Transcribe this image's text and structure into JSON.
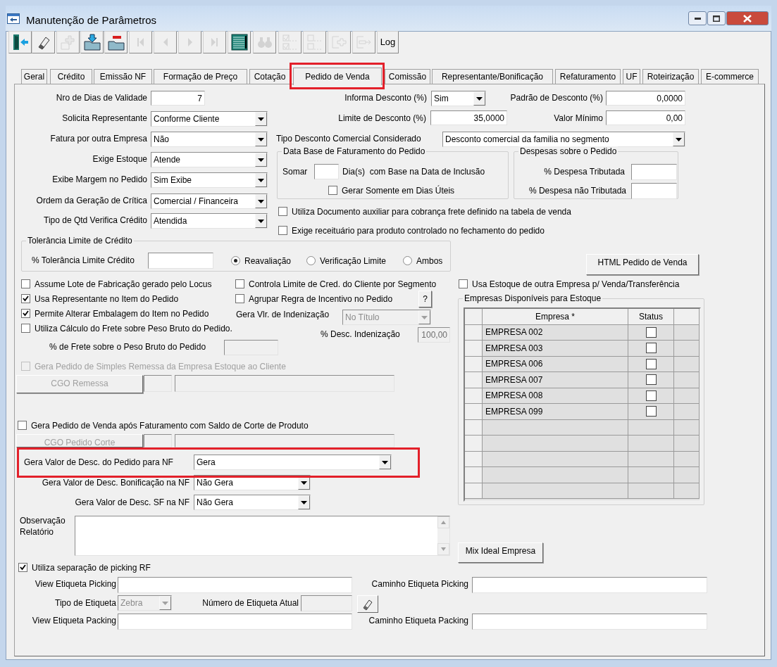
{
  "window": {
    "title": "Manutenção de Parâmetros"
  },
  "toolbar": [
    {
      "kind": "exit",
      "disabled": false
    },
    {
      "kind": "eraser",
      "disabled": false
    },
    {
      "kind": "add",
      "disabled": true
    },
    {
      "kind": "save",
      "disabled": false
    },
    {
      "kind": "delete",
      "disabled": false
    },
    {
      "kind": "first",
      "disabled": true
    },
    {
      "kind": "prev",
      "disabled": true
    },
    {
      "kind": "next",
      "disabled": true
    },
    {
      "kind": "last",
      "disabled": true
    },
    {
      "kind": "grid",
      "disabled": false
    },
    {
      "kind": "find",
      "disabled": true
    },
    {
      "kind": "check-all",
      "disabled": true
    },
    {
      "kind": "uncheck-all",
      "disabled": true
    },
    {
      "kind": "insert",
      "disabled": true
    },
    {
      "kind": "export",
      "disabled": true
    },
    {
      "kind": "text",
      "label": "Log",
      "disabled": false
    }
  ],
  "tabs": [
    {
      "label": "Geral",
      "selected": false
    },
    {
      "label": "Crédito",
      "selected": false
    },
    {
      "label": "Emissão NF",
      "selected": false
    },
    {
      "label": "Formação de Preço",
      "selected": false
    },
    {
      "label": "Cotação",
      "selected": false
    },
    {
      "label": "Pedido de Venda",
      "selected": true
    },
    {
      "label": "Comissão",
      "selected": false
    },
    {
      "label": "Representante/Bonificação",
      "selected": false
    },
    {
      "label": "Refaturamento",
      "selected": false
    },
    {
      "label": "UF",
      "selected": false
    },
    {
      "label": "Roteirização",
      "selected": false
    },
    {
      "label": "E-commerce",
      "selected": false
    }
  ],
  "controls": [
    {
      "kind": "label",
      "text": "Nro de Dias de Validade"
    },
    {
      "kind": "text",
      "value": "7",
      "disabled": false
    },
    {
      "kind": "label",
      "text": "Informa Desconto (%)"
    },
    {
      "kind": "combo",
      "value": "Sim",
      "disabled": false
    },
    {
      "kind": "label",
      "text": "Padrão de Desconto (%)"
    },
    {
      "kind": "text",
      "value": "0,0000",
      "disabled": false
    },
    {
      "kind": "label",
      "text": "Solicita Representante"
    },
    {
      "kind": "combo",
      "value": "Conforme Cliente",
      "disabled": false
    },
    {
      "kind": "label",
      "text": "Limite de Desconto (%)"
    },
    {
      "kind": "text",
      "value": "35,0000",
      "disabled": false
    },
    {
      "kind": "label",
      "text": "Valor Mínimo"
    },
    {
      "kind": "text",
      "value": "0,00",
      "disabled": false
    },
    {
      "kind": "label",
      "text": "Fatura por outra Empresa"
    },
    {
      "kind": "combo",
      "value": "Não",
      "disabled": false
    },
    {
      "kind": "label",
      "text": "Tipo Desconto Comercial Considerado"
    },
    {
      "kind": "combo",
      "value": "Desconto comercial da familia no segmento",
      "disabled": false
    },
    {
      "kind": "group",
      "title": "Data Base de Faturamento do Pedido"
    },
    {
      "kind": "label",
      "text": "Somar"
    },
    {
      "kind": "text",
      "disabled": false
    },
    {
      "kind": "label",
      "text": "Dia(s)  com Base na Data de Inclusão"
    },
    {
      "kind": "checkbox",
      "text": "Gerar Somente em Dias Úteis",
      "checked": false,
      "disabled": false
    },
    {
      "kind": "group",
      "title": "Despesas sobre o Pedido"
    },
    {
      "kind": "label",
      "text": "% Despesa Tributada"
    },
    {
      "kind": "text",
      "disabled": false
    },
    {
      "kind": "label",
      "text": "% Despesa não Tributada"
    },
    {
      "kind": "text",
      "disabled": false
    },
    {
      "kind": "label",
      "text": "Exige Estoque"
    },
    {
      "kind": "combo",
      "value": "Atende",
      "disabled": false
    },
    {
      "kind": "label",
      "text": "Exibe Margem no Pedido"
    },
    {
      "kind": "combo",
      "value": "Sim Exibe",
      "disabled": false
    },
    {
      "kind": "label",
      "text": "Ordem da Geração de Crítica"
    },
    {
      "kind": "combo",
      "value": "Comercial / Financeira",
      "disabled": false
    },
    {
      "kind": "checkbox",
      "text": "Utiliza Documento auxiliar para cobrança frete definido na tabela de venda",
      "checked": false,
      "disabled": false
    },
    {
      "kind": "label",
      "text": "Tipo de Qtd Verifica Crédito"
    },
    {
      "kind": "combo",
      "value": "Atendida",
      "disabled": false
    },
    {
      "kind": "checkbox",
      "text": "Exige receituário para produto controlado no fechamento do pedido",
      "checked": false,
      "disabled": false
    },
    {
      "kind": "group",
      "title": "Tolerância Limite de Crédito"
    },
    {
      "kind": "label",
      "text": "% Tolerância Limite Crédito"
    },
    {
      "kind": "text",
      "disabled": false
    },
    {
      "kind": "radio",
      "text": "Reavaliação",
      "selected": true
    },
    {
      "kind": "radio",
      "text": "Verificação Limite",
      "selected": false
    },
    {
      "kind": "radio",
      "text": "Ambos",
      "selected": false
    },
    {
      "kind": "button",
      "text": "HTML Pedido de Venda",
      "disabled": false
    },
    {
      "kind": "checkbox",
      "text": "Assume Lote de Fabricação gerado pelo Locus",
      "checked": false,
      "disabled": false
    },
    {
      "kind": "checkbox",
      "text": "Controla Limite de Cred. do Cliente por Segmento",
      "checked": false,
      "disabled": false
    },
    {
      "kind": "checkbox",
      "text": "Usa Estoque de outra Empresa p/ Venda/Transferência",
      "checked": false,
      "disabled": false
    },
    {
      "kind": "checkbox",
      "text": "Usa Representante no Item do Pedido",
      "checked": true,
      "disabled": false
    },
    {
      "kind": "checkbox",
      "text": "Agrupar Regra de Incentivo no Pedido",
      "checked": false,
      "disabled": false
    },
    {
      "kind": "button",
      "text": "?",
      "disabled": false
    },
    {
      "kind": "checkbox",
      "text": "Permite Alterar Embalagem do Item no Pedido",
      "checked": true,
      "disabled": false
    },
    {
      "kind": "label",
      "text": "Gera Vlr. de Indenização"
    },
    {
      "kind": "combo",
      "value": "No Título",
      "disabled": true
    },
    {
      "kind": "checkbox",
      "text": "Utiliza Cálculo do Frete sobre Peso Bruto do Pedido.",
      "checked": false,
      "disabled": false
    },
    {
      "kind": "label",
      "text": "% Desc. Indenização"
    },
    {
      "kind": "text",
      "value": "100,00",
      "disabled": true
    },
    {
      "kind": "label",
      "text": "% de Frete sobre o Peso Bruto do Pedido"
    },
    {
      "kind": "text",
      "disabled": true
    },
    {
      "kind": "checkbox",
      "text": "Gera Pedido de Simples Remessa da Empresa Estoque ao Cliente",
      "checked": false,
      "disabled": true
    },
    {
      "kind": "button",
      "text": "CGO Remessa",
      "disabled": true
    },
    {
      "kind": "text",
      "disabled": true
    },
    {
      "kind": "text",
      "disabled": true
    },
    {
      "kind": "checkbox",
      "text": "Gera Pedido de Venda após Faturamento com Saldo de Corte de Produto",
      "checked": false,
      "disabled": false
    },
    {
      "kind": "button",
      "text": "CGO Pedido Corte",
      "disabled": true
    },
    {
      "kind": "text",
      "disabled": true
    },
    {
      "kind": "text",
      "disabled": true
    },
    {
      "kind": "label",
      "text": "Gera Valor de Desc. do Pedido para NF"
    },
    {
      "kind": "combo",
      "value": "Gera",
      "disabled": false
    },
    {
      "kind": "label",
      "text": "Gera Valor de Desc. Bonificação na NF"
    },
    {
      "kind": "combo",
      "value": "Não Gera",
      "disabled": false
    },
    {
      "kind": "label",
      "text": "Gera Valor de Desc. SF na NF"
    },
    {
      "kind": "combo",
      "value": "Não Gera",
      "disabled": false
    },
    {
      "kind": "label",
      "text": "Observação Relatório"
    },
    {
      "kind": "memo",
      "disabled": false
    },
    {
      "kind": "button",
      "text": "Mix Ideal Empresa",
      "disabled": false
    },
    {
      "kind": "checkbox",
      "text": "Utiliza separação de picking RF",
      "checked": true,
      "disabled": false
    },
    {
      "kind": "label",
      "text": "View Etiqueta Picking"
    },
    {
      "kind": "text",
      "disabled": false
    },
    {
      "kind": "label",
      "text": "Caminho Etiqueta Picking"
    },
    {
      "kind": "text",
      "disabled": false
    },
    {
      "kind": "label",
      "text": "Tipo de Etiqueta"
    },
    {
      "kind": "combo",
      "value": "Zebra",
      "disabled": true
    },
    {
      "kind": "label",
      "text": "Número de Etiqueta Atual"
    },
    {
      "kind": "text",
      "disabled": true
    },
    {
      "kind": "icon-button",
      "disabled": false
    },
    {
      "kind": "label",
      "text": "View Etiqueta Packing"
    },
    {
      "kind": "text",
      "disabled": false
    },
    {
      "kind": "label",
      "text": "Caminho Etiqueta Packing"
    },
    {
      "kind": "text",
      "disabled": false
    }
  ],
  "stock_grid": {
    "title": "Empresas Disponíveis para Estoque",
    "columns": [
      "Empresa *",
      "Status"
    ],
    "rows": [
      {
        "empresa": "EMPRESA 002",
        "status": false
      },
      {
        "empresa": "EMPRESA 003",
        "status": false
      },
      {
        "empresa": "EMPRESA 006",
        "status": false
      },
      {
        "empresa": "EMPRESA 007",
        "status": false
      },
      {
        "empresa": "EMPRESA 008",
        "status": false
      },
      {
        "empresa": "EMPRESA 099",
        "status": false
      }
    ]
  }
}
